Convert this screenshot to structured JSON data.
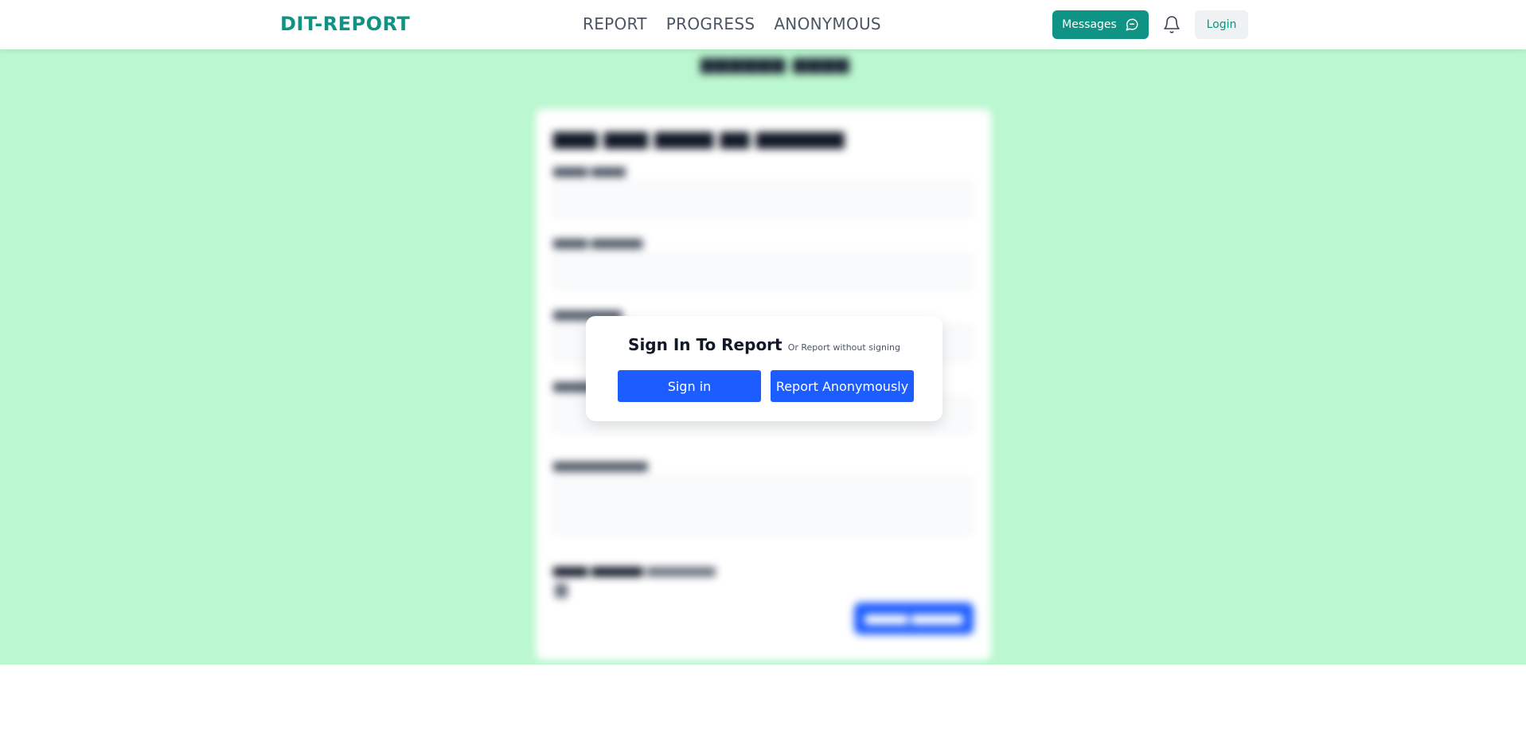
{
  "navbar": {
    "brand": "DIT-REPORT",
    "links": [
      "REPORT",
      "PROGRESS",
      "ANONYMOUS"
    ],
    "messages_label": "Messages",
    "login_label": "Login"
  },
  "modal": {
    "title": "Sign In To Report",
    "subtitle": "Or Report without signing",
    "signin_label": "Sign in",
    "anonymous_label": "Report Anonymously"
  },
  "colors": {
    "brand": "#0e9384",
    "background": "#bbf7d0",
    "primary_button": "#1d5cff"
  },
  "icons": {
    "messages": "chat-bubble-icon",
    "notifications": "bell-icon"
  }
}
